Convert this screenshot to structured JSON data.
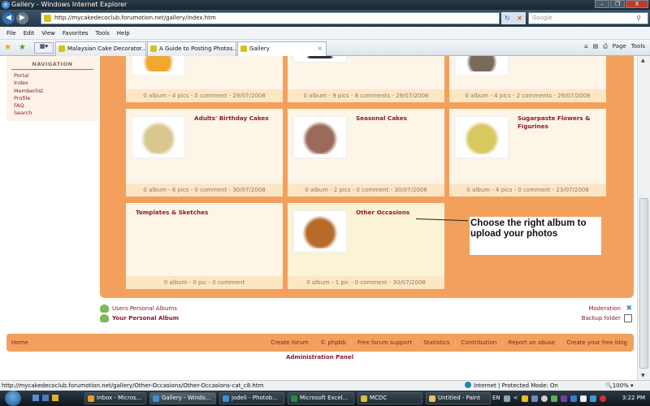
{
  "window": {
    "title": "Gallery - Windows Internet Explorer",
    "buttons": {
      "minimize": "–",
      "restore": "❐",
      "close": "X"
    }
  },
  "address_bar": {
    "url": "http://mycakedecoclub.forumotion.net/gallery/index.htm",
    "search_placeholder": "Google"
  },
  "menu": [
    "File",
    "Edit",
    "View",
    "Favorites",
    "Tools",
    "Help"
  ],
  "tabs": [
    {
      "label": "Malaysian Cake Decorator...",
      "active": false
    },
    {
      "label": "A Guide to Posting Photos...",
      "active": false
    },
    {
      "label": "Gallery",
      "active": true
    }
  ],
  "command_bar": {
    "home": "⌂",
    "feeds": "▤",
    "print": "⎙",
    "page": "Page",
    "tools": "Tools"
  },
  "navigation": {
    "title": "NAVIGATION",
    "items": [
      "Portal",
      "Index",
      "Memberlist",
      "Profile",
      "FAQ",
      "Search"
    ]
  },
  "albums": [
    {
      "title": "",
      "footer": "0 album - 4 pics - 0 comment - 29/07/2008",
      "thumb_color": "#f0a830"
    },
    {
      "title": "",
      "footer": "0 album - 9 pics - 8 comments - 29/07/2008",
      "thumb_color": "#2a3038"
    },
    {
      "title": "",
      "footer": "0 album - 4 pics - 2 comments - 29/07/2008",
      "thumb_color": "#7a6a58"
    },
    {
      "title": "Adults' Birthday Cakes",
      "footer": "0 album - 6 pics - 0 comment - 30/07/2008",
      "thumb_color": "#d8c890"
    },
    {
      "title": "Seasonal Cakes",
      "footer": "0 album - 2 pics - 0 comment - 30/07/2008",
      "thumb_color": "#9a6a5a"
    },
    {
      "title": "Sugarpaste Flowers & Figurines",
      "footer": "0 album - 4 pics - 0 comment - 23/07/2008",
      "thumb_color": "#d8c860"
    },
    {
      "title": "Templates & Sketches",
      "footer": "0 album - 0 pic - 0 comment",
      "thumb_color": ""
    },
    {
      "title": "Other Occasions",
      "footer": "0 album - 1 pic - 0 comment - 30/07/2008",
      "thumb_color": "#b86a2a"
    }
  ],
  "callout": {
    "text": "Choose the right album to upload your photos"
  },
  "album_links": {
    "users": "Users Personal Albums",
    "yours": "Your Personal Album"
  },
  "mod_links": {
    "moderation": "Moderation",
    "backup": "Backup folder"
  },
  "footer": {
    "home": "Home",
    "links": [
      "Create forum",
      "© phpbb",
      "Free forum support",
      "Statistics",
      "Contribution",
      "Report an abuse",
      "Create your free blog"
    ],
    "admin": "Administration Panel"
  },
  "status": {
    "url": "http://mycakedecoclub.forumotion.net/gallery/Other-Occasions/Other-Occasions-cat_c8.htm",
    "zone": "Internet | Protected Mode: On",
    "zoom": "100%"
  },
  "taskbar": {
    "tasks": [
      {
        "label": "Inbox - Micros...",
        "color": "#e8a020"
      },
      {
        "label": "Gallery - Windo...",
        "color": "#3b8ed8"
      },
      {
        "label": "jodeli - Photob...",
        "color": "#3b8ed8"
      },
      {
        "label": "Microsoft Excel...",
        "color": "#2a8a3a"
      },
      {
        "label": "MCDC",
        "color": "#d8c040"
      },
      {
        "label": "Untitled - Paint",
        "color": "#e8c060"
      }
    ],
    "lang": "EN",
    "clock": "3:22 PM"
  },
  "colors": {
    "accent": "#f3a05d",
    "link": "#8a1c2c",
    "card_bg": "#fdf5e8",
    "card_footer": "#fde6c4"
  }
}
